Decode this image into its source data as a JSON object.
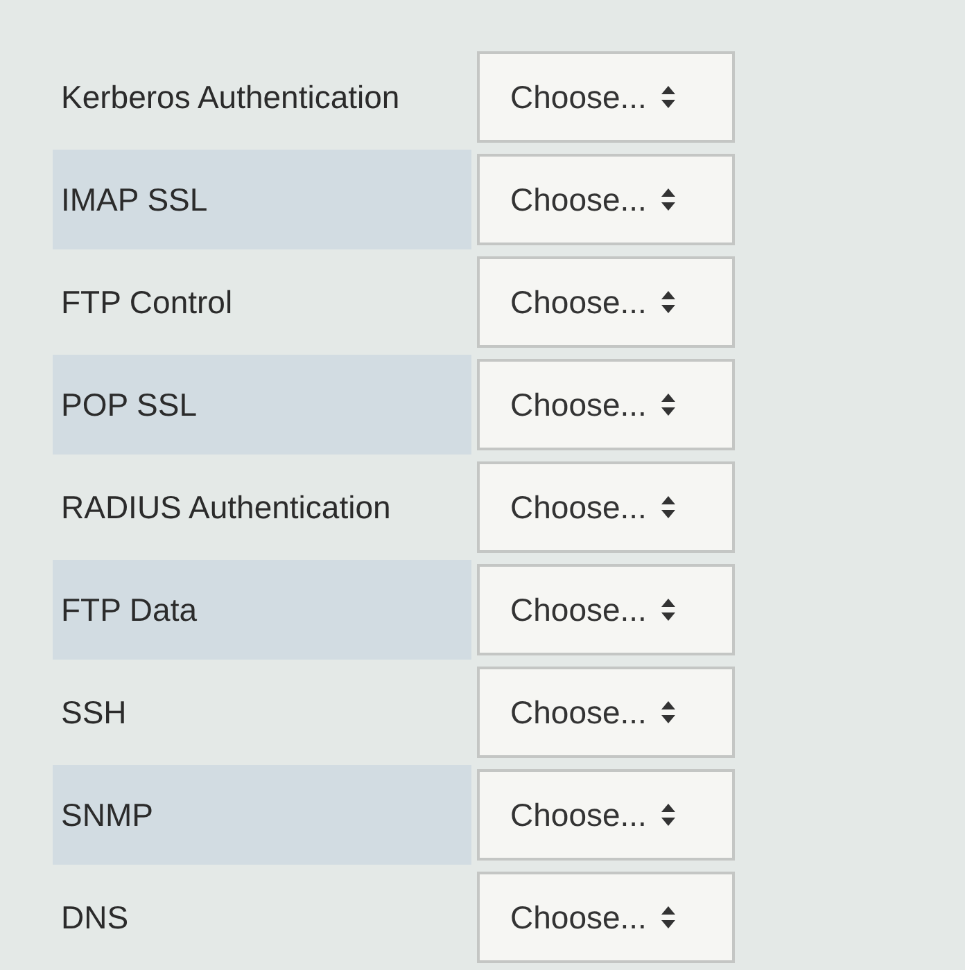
{
  "rows": [
    {
      "label": "Kerberos Authentication",
      "shaded": false,
      "select": "Choose..."
    },
    {
      "label": "IMAP SSL",
      "shaded": true,
      "select": "Choose..."
    },
    {
      "label": "FTP Control",
      "shaded": false,
      "select": "Choose..."
    },
    {
      "label": "POP SSL",
      "shaded": true,
      "select": "Choose..."
    },
    {
      "label": "RADIUS Authentication",
      "shaded": false,
      "select": "Choose..."
    },
    {
      "label": "FTP Data",
      "shaded": true,
      "select": "Choose..."
    },
    {
      "label": "SSH",
      "shaded": false,
      "select": "Choose..."
    },
    {
      "label": "SNMP",
      "shaded": true,
      "select": "Choose..."
    },
    {
      "label": "DNS",
      "shaded": false,
      "select": "Choose..."
    }
  ]
}
